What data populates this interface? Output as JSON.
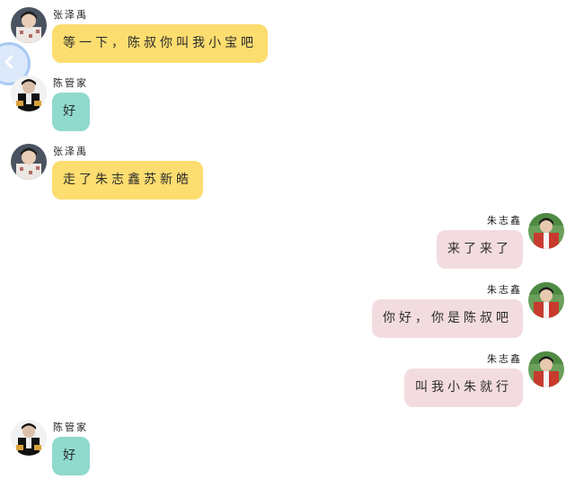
{
  "chat": {
    "messages": [
      {
        "side": "left",
        "name": "张泽禹",
        "text": "等一下，陈叔你叫我小宝吧",
        "bubble_color": "#fcdd6f",
        "avatar": "zhang-zeyu-avatar"
      },
      {
        "side": "left",
        "name": "陈管家",
        "text": "好",
        "bubble_color": "#8fd9cd",
        "avatar": "butler-chen-avatar"
      },
      {
        "side": "left",
        "name": "张泽禹",
        "text": "走了朱志鑫苏新皓",
        "bubble_color": "#fcdd6f",
        "avatar": "zhang-zeyu-avatar"
      },
      {
        "side": "right",
        "name": "朱志鑫",
        "text": "来了来了",
        "bubble_color": "#f3dcdf",
        "avatar": "zhu-zhixin-avatar"
      },
      {
        "side": "right",
        "name": "朱志鑫",
        "text": "你好，你是陈叔吧",
        "bubble_color": "#f3dcdf",
        "avatar": "zhu-zhixin-avatar"
      },
      {
        "side": "right",
        "name": "朱志鑫",
        "text": "叫我小朱就行",
        "bubble_color": "#f3dcdf",
        "avatar": "zhu-zhixin-avatar"
      },
      {
        "side": "left",
        "name": "陈管家",
        "text": "好",
        "bubble_color": "#8fd9cd",
        "avatar": "butler-chen-avatar"
      }
    ]
  },
  "controls": {
    "back_icon": "chevron-left-icon"
  }
}
